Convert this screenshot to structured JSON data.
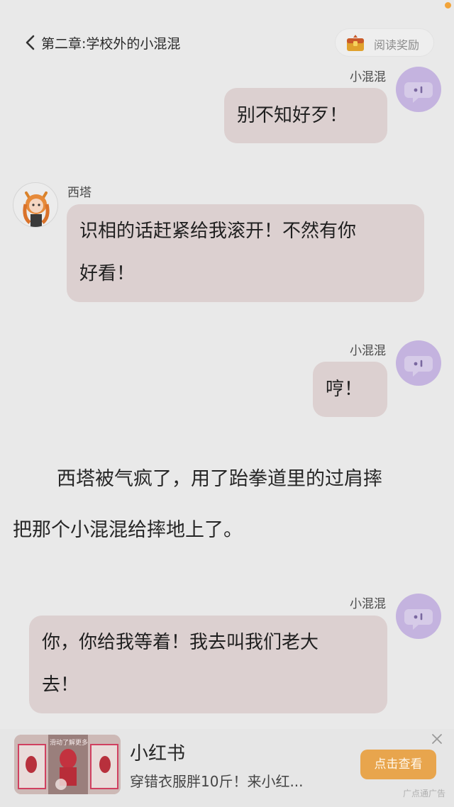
{
  "header": {
    "chapter_title": "第二章:学校外的小混混",
    "reward_label": "阅读奖励"
  },
  "messages": [
    {
      "speaker": "小混混",
      "text": "别不知好歹！"
    },
    {
      "speaker": "西塔",
      "text_line1": "识相的话赶紧给我滚开！不然有你",
      "text_line2": "好看！"
    },
    {
      "speaker": "小混混",
      "text": "哼！"
    }
  ],
  "narration": {
    "line1": "西塔被气疯了，用了跆拳道里的过肩摔",
    "line2": "把那个小混混给摔地上了。"
  },
  "last_message": {
    "speaker": "小混混",
    "text_line1": "你，你给我等着！我去叫我们老大",
    "text_line2": "去！"
  },
  "ad": {
    "title": "小红书",
    "description": "穿错衣服胖10斤！来小红...",
    "cta": "点击查看",
    "tag": "广点通广告",
    "thumb_caption": "滑动了解更多"
  },
  "colors": {
    "bubble": "#dcd0d0",
    "bot_avatar": "#c4b3df",
    "cta": "#e8a54d",
    "background": "#e9e9e9"
  }
}
